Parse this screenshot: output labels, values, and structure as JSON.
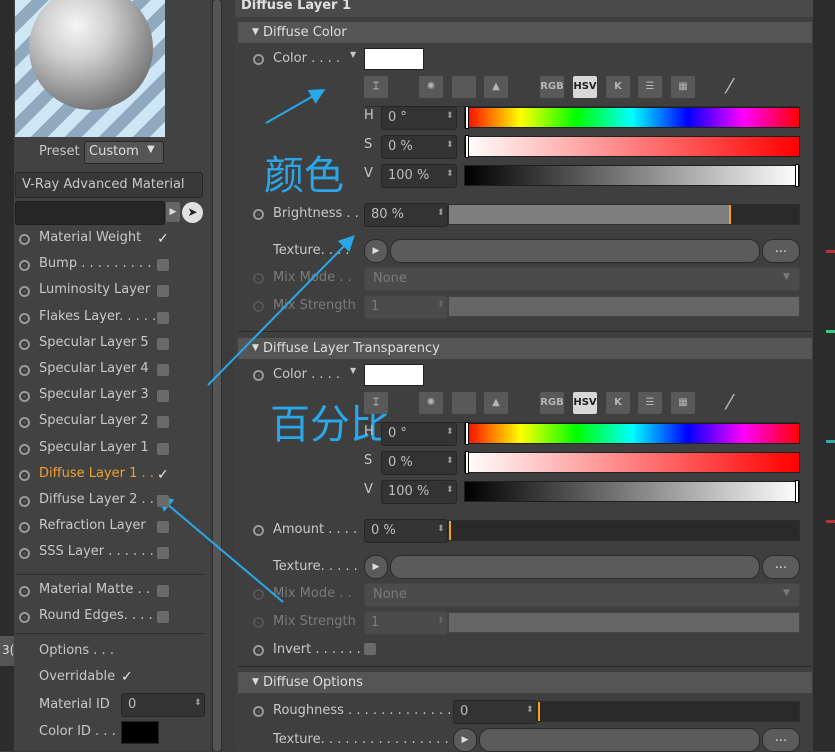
{
  "preset": {
    "label": "Preset",
    "value": "Custom"
  },
  "material_name": "V-Ray Advanced Material",
  "layers": [
    {
      "label": "Material Weight",
      "checked": true
    },
    {
      "label": "Bump . . . . . . . . . .",
      "checked": false
    },
    {
      "label": "Luminosity Layer",
      "checked": false
    },
    {
      "label": "Flakes Layer. . . . .",
      "checked": false
    },
    {
      "label": "Specular Layer 5",
      "checked": false
    },
    {
      "label": "Specular Layer 4",
      "checked": false
    },
    {
      "label": "Specular Layer 3",
      "checked": false
    },
    {
      "label": "Specular Layer 2",
      "checked": false
    },
    {
      "label": "Specular Layer 1",
      "checked": false
    },
    {
      "label": "Diffuse Layer 1 . .",
      "checked": true,
      "active": true
    },
    {
      "label": "Diffuse Layer 2 . .",
      "checked": false
    },
    {
      "label": "Refraction Layer",
      "checked": false
    },
    {
      "label": "SSS Layer . . . . . . .",
      "checked": false
    }
  ],
  "extra_layers": [
    {
      "label": "Material Matte . .",
      "checked": false
    },
    {
      "label": "Round Edges. . . .",
      "checked": false
    }
  ],
  "options": {
    "title": "Options . . .",
    "overridable_label": "Overridable",
    "overridable_checked": true,
    "material_id_label": "Material ID",
    "material_id_value": "0",
    "color_id_label": "Color ID . . ."
  },
  "side_fragment": "3(",
  "panel_title": "Diffuse Layer 1",
  "diffuse_color": {
    "header": "Diffuse Color",
    "color_label": "Color . . . .",
    "color_swatch": "#ffffff",
    "modes": [
      "RGB",
      "HSV",
      "K"
    ],
    "h_label": "H",
    "h_value": "0 °",
    "s_label": "S",
    "s_value": "0 %",
    "v_label": "V",
    "v_value": "100 %",
    "brightness_label": "Brightness . .",
    "brightness_value": "80 %",
    "brightness_fraction": 0.8,
    "texture_label": "Texture. . . .",
    "texture_btn": "...",
    "mix_mode_label": "Mix Mode . .",
    "mix_mode_value": "None",
    "mix_strength_label": "Mix Strength",
    "mix_strength_value": "1"
  },
  "diffuse_transparency": {
    "header": "Diffuse Layer Transparency",
    "color_label": "Color . . . .",
    "color_swatch": "#ffffff",
    "modes": [
      "RGB",
      "HSV",
      "K"
    ],
    "h_label": "H",
    "h_value": "0 °",
    "s_label": "S",
    "s_value": "0 %",
    "v_label": "V",
    "v_value": "100 %",
    "amount_label": "Amount . . . .",
    "amount_value": "0 %",
    "amount_fraction": 0,
    "texture_label": "Texture. . . . .",
    "texture_btn": "...",
    "mix_mode_label": "Mix Mode . .",
    "mix_mode_value": "None",
    "mix_strength_label": "Mix Strength",
    "mix_strength_value": "1",
    "invert_label": "Invert . . . . . ."
  },
  "diffuse_options": {
    "header": "Diffuse Options",
    "roughness_label": "Roughness . . . . . . . . . . . . .",
    "roughness_value": "0",
    "texture_label": "Texture. . . . . . . . . . . . . . . .",
    "texture_btn": "..."
  },
  "annotations": {
    "color_text": "颜色",
    "percent_text": "百分比",
    "accent": "#2aa7e8"
  },
  "colors": {
    "active_layer": "#f0a030",
    "slider_marker": "#f0a020",
    "background": "#3f3f3f"
  }
}
